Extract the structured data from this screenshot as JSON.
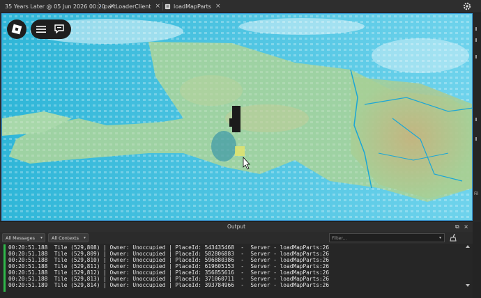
{
  "tabs": [
    {
      "label": "35 Years Later @ 05 Jun 2026 00:20",
      "icon": "place-icon",
      "close": "×"
    },
    {
      "label": "partLoaderClient",
      "icon": "script-icon",
      "close": "×"
    },
    {
      "label": "loadMapParts",
      "icon": "script-icon",
      "close": "×"
    }
  ],
  "output": {
    "title": "Output",
    "filter_messages": "All Messages",
    "filter_contexts": "All Contexts",
    "filter_placeholder": "Filter...",
    "side_label": "Fil",
    "lines": [
      "00:20:51.188  Tile (529,808) | Owner: Unoccupied | PlaceId: 543435468  -  Server - loadMapParts:26",
      "00:20:51.188  Tile (529,809) | Owner: Unoccupied | PlaceId: 582806883  -  Server - loadMapParts:26",
      "00:20:51.188  Tile (529,810) | Owner: Unoccupied | PlaceId: 596880386  -  Server - loadMapParts:26",
      "00:20:51.188  Tile (529,811) | Owner: Unoccupied | PlaceId: 619605153  -  Server - loadMapParts:26",
      "00:20:51.188  Tile (529,812) | Owner: Unoccupied | PlaceId: 356855616  -  Server - loadMapParts:26",
      "00:20:51.188  Tile (529,813) | Owner: Unoccupied | PlaceId: 371060711  -  Server - loadMapParts:26",
      "00:20:51.189  Tile (529,814) | Owner: Unoccupied | PlaceId: 393784966  -  Server - loadMapParts:26"
    ]
  },
  "colors": {
    "accent": "#3aa0e0",
    "server_bar": "#2fb84a",
    "ocean": "#4ec6e4"
  }
}
